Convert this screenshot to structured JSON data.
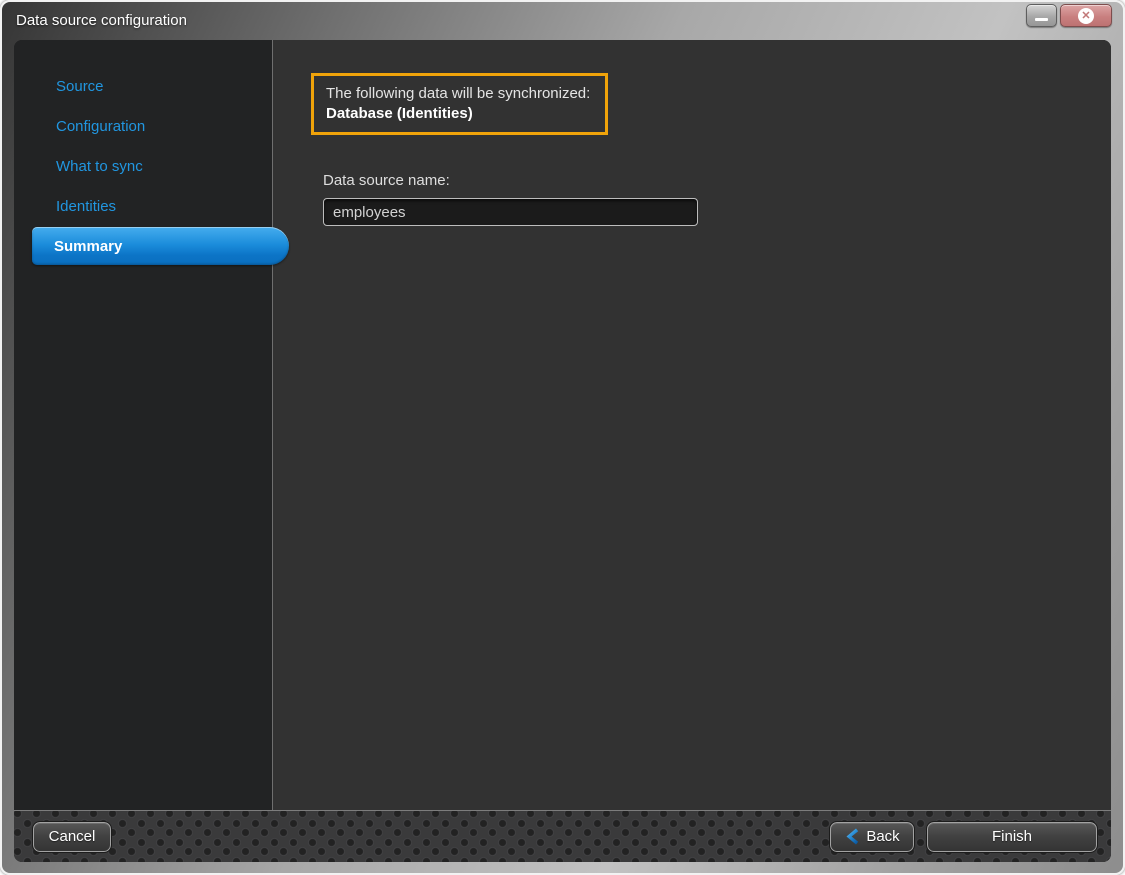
{
  "window": {
    "title": "Data source configuration",
    "controls": {
      "minimize_icon": "minimize",
      "close_icon": "close"
    }
  },
  "sidebar": {
    "items": [
      {
        "label": "Source",
        "active": false
      },
      {
        "label": "Configuration",
        "active": false
      },
      {
        "label": "What to sync",
        "active": false
      },
      {
        "label": "Identities",
        "active": false
      },
      {
        "label": "Summary",
        "active": true
      }
    ]
  },
  "content": {
    "sync_intro": "The following data will be synchronized:",
    "sync_item": "Database (Identities)",
    "name_label": "Data source name:",
    "name_value": "employees"
  },
  "footer": {
    "cancel_label": "Cancel",
    "back_label": "Back",
    "finish_label": "Finish"
  },
  "colors": {
    "link_blue": "#2196e0",
    "selected_top": "#45adee",
    "selected_bottom": "#0a6fc0",
    "highlight_border": "#f0a30a",
    "close_button": "#c17878"
  }
}
